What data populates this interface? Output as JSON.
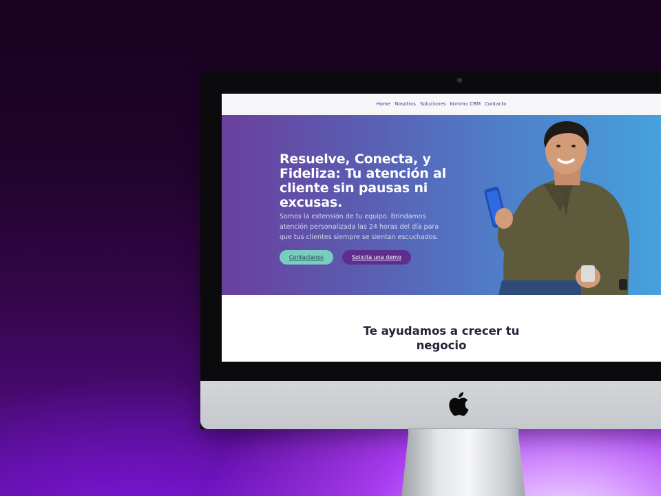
{
  "nav": {
    "items": [
      "Home",
      "Nosotros",
      "Soluciones",
      "Kommo CRM",
      "Contacto"
    ]
  },
  "hero": {
    "title_lines": [
      "Resuelve, Conecta, y",
      "Fideliza: Tu atención al",
      "cliente sin pausas ni",
      "excusas."
    ],
    "subtitle_lines": [
      "Somos la extensión de tu equipo. Brindamos",
      "atención personalizada las 24 horas del día para",
      "que tus clientes siempre se sientan escuchados."
    ],
    "btn_contact": "Contactanos",
    "btn_demo": "Solicita una demo"
  },
  "section": {
    "title_lines": [
      "Te ayudamos a crecer tu",
      "negocio"
    ]
  },
  "colors": {
    "hero_start": "#6a3f9e",
    "hero_end": "#46a1dd",
    "btn_contact": "#79cdbf",
    "btn_demo": "#5e2e8f",
    "nav_text": "#4c3a8c"
  },
  "icons": {
    "brand": "apple-logo-icon"
  }
}
